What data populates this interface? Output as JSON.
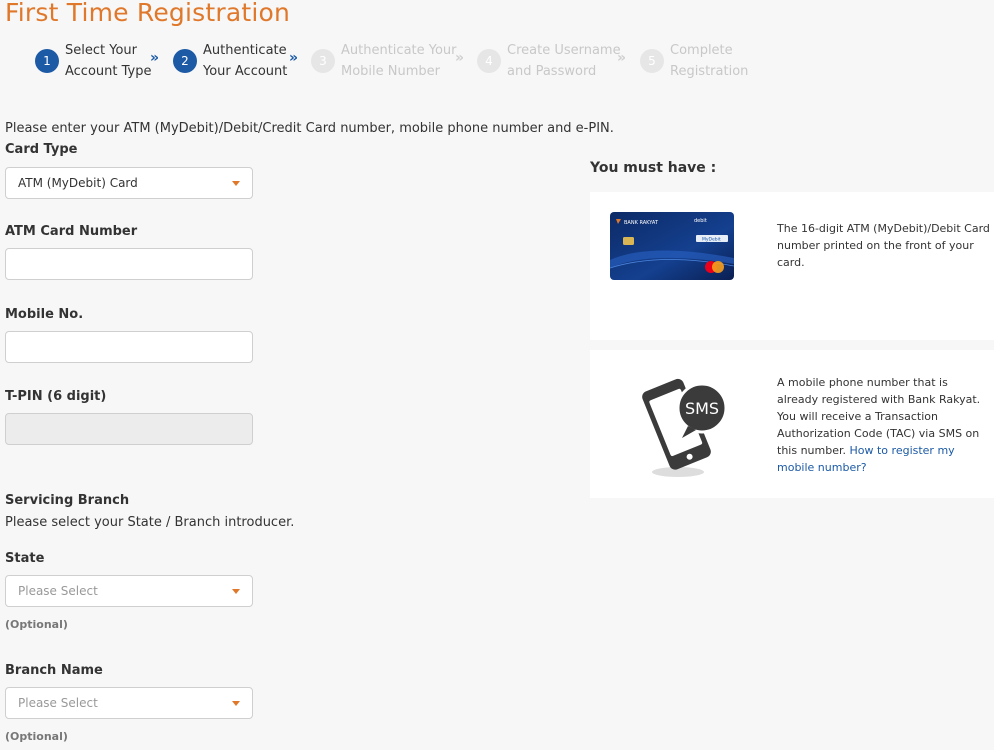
{
  "page": {
    "title": "First Time Registration"
  },
  "steps": [
    {
      "num": "1",
      "line1": "Select Your",
      "line2": "Account Type",
      "state": "active"
    },
    {
      "num": "2",
      "line1": "Authenticate",
      "line2": "Your Account",
      "state": "active"
    },
    {
      "num": "3",
      "line1": "Authenticate Your",
      "line2": "Mobile Number",
      "state": "inactive"
    },
    {
      "num": "4",
      "line1": "Create Username",
      "line2": "and Password",
      "state": "inactive"
    },
    {
      "num": "5",
      "line1": "Complete",
      "line2": "Registration",
      "state": "inactive"
    }
  ],
  "step_separator": "»",
  "form": {
    "intro": "Please enter your ATM (MyDebit)/Debit/Credit Card number, mobile phone number and e-PIN.",
    "card_type_label": "Card Type",
    "card_type_value": "ATM (MyDebit) Card",
    "atm_label": "ATM Card Number",
    "atm_value": "",
    "mobile_label": "Mobile No.",
    "mobile_value": "",
    "tpin_label": "T-PIN (6 digit)",
    "tpin_value": "",
    "branch_heading": "Servicing Branch",
    "branch_intro": "Please select your State / Branch introducer.",
    "state_label": "State",
    "state_placeholder": "Please Select",
    "state_optional": "(Optional)",
    "branch_label": "Branch Name",
    "branch_placeholder": "Please Select",
    "branch_optional": "(Optional)"
  },
  "requirements": {
    "heading": "You must have :",
    "card_desc": "The 16-digit ATM (MyDebit)/Debit Card number printed on the front of your card.",
    "card_brand": "BANK RAKYAT",
    "card_debit": "debit",
    "card_mydebit": "MyDebit",
    "mobile_line1": "A mobile phone number that is",
    "mobile_line2": "already registered with Bank Rakyat.",
    "mobile_line3": "You will receive a Transaction Authorization Code (TAC) via SMS on this number.",
    "mobile_link": "How to register my mobile number?",
    "sms_text": "SMS"
  },
  "colors": {
    "accent": "#e0782b",
    "primary": "#1c5aa6"
  }
}
